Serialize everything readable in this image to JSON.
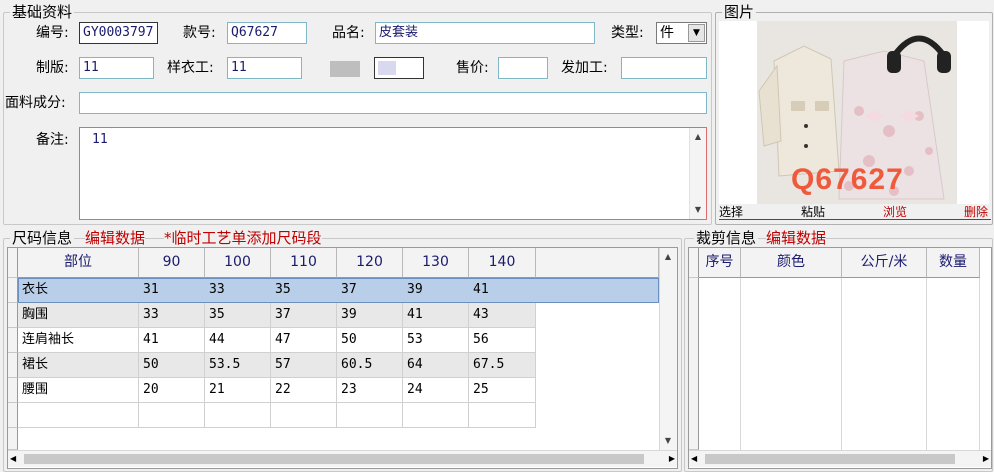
{
  "basic": {
    "title": "基础资料",
    "fields": {
      "code_label": "编号:",
      "code_value": "GY0003797",
      "style_label": "款号:",
      "style_value": "Q67627",
      "name_label": "品名:",
      "name_value": "皮套装",
      "type_label": "类型:",
      "type_value": "件",
      "pattern_label": "制版:",
      "pattern_value": "11",
      "sample_label": "样衣工:",
      "sample_value": "11",
      "price_label": "售价:",
      "price_value": "",
      "processor_label": "发加工:",
      "processor_value": "",
      "fabric_label": "面料成分:",
      "fabric_value": "",
      "remark_label": "备注:",
      "remark_value": "11"
    }
  },
  "image": {
    "title": "图片",
    "overlay_text": "Q67627",
    "buttons": {
      "select": "选择",
      "paste": "粘贴",
      "browse": "浏览",
      "delete": "删除"
    }
  },
  "size_section": {
    "title": "尺码信息",
    "edit_link": "编辑数据",
    "add_link": "*临时工艺单添加尺码段",
    "columns": [
      "部位",
      "90",
      "100",
      "110",
      "120",
      "130",
      "140"
    ],
    "rows": [
      [
        "衣长",
        "31",
        "33",
        "35",
        "37",
        "39",
        "41"
      ],
      [
        "胸围",
        "33",
        "35",
        "37",
        "39",
        "41",
        "43"
      ],
      [
        "连肩袖长",
        "41",
        "44",
        "47",
        "50",
        "53",
        "56"
      ],
      [
        "裙长",
        "50",
        "53.5",
        "57",
        "60.5",
        "64",
        "67.5"
      ],
      [
        "腰围",
        "20",
        "21",
        "22",
        "23",
        "24",
        "25"
      ]
    ]
  },
  "cut_section": {
    "title": "裁剪信息",
    "edit_link": "编辑数据",
    "columns": [
      "序号",
      "颜色",
      "公斤/米",
      "数量"
    ]
  },
  "colors": {
    "accent_red": "#c00000",
    "input_border": "#7fb7c6",
    "selected_row": "#b9cfe9"
  }
}
